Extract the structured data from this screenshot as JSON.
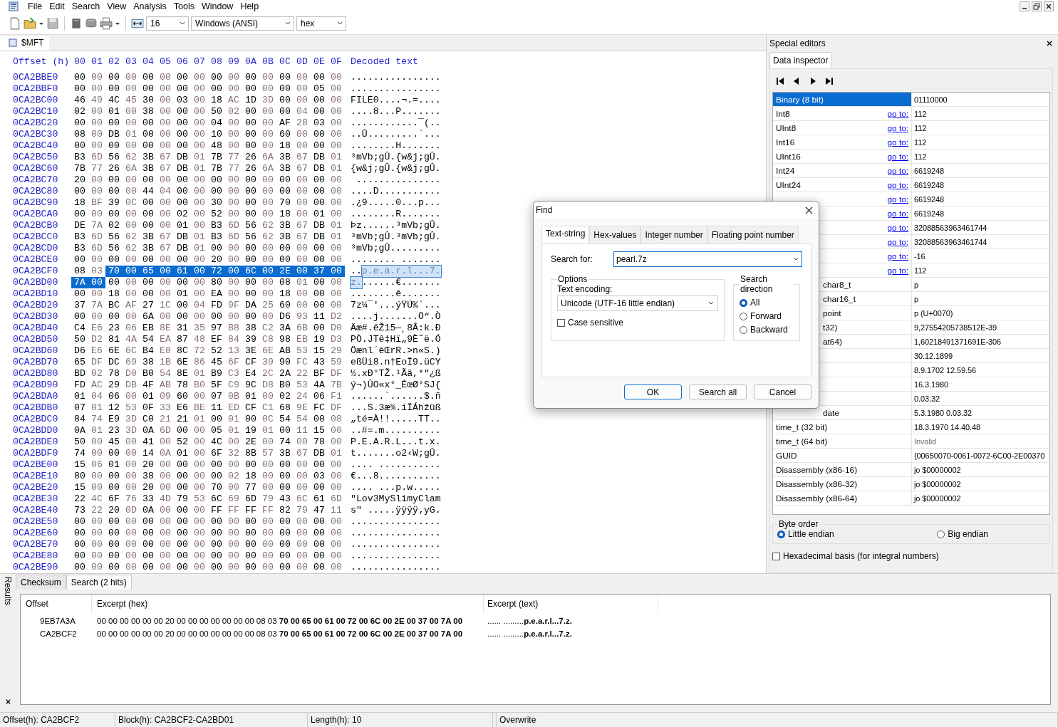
{
  "menu": [
    "File",
    "Edit",
    "Search",
    "View",
    "Analysis",
    "Tools",
    "Window",
    "Help"
  ],
  "toolbar": {
    "columns_value": "16",
    "charset": "Windows (ANSI)",
    "base": "hex"
  },
  "document_tab": {
    "label": "$MFT",
    "selected": true
  },
  "hex_view": {
    "header": {
      "offset": "Offset (h)",
      "columns": [
        "00",
        "01",
        "02",
        "03",
        "04",
        "05",
        "06",
        "07",
        "08",
        "09",
        "0A",
        "0B",
        "0C",
        "0D",
        "0E",
        "0F"
      ],
      "text": "Decoded text"
    },
    "rows": [
      {
        "offset": "0CA2BBE0",
        "hex": [
          {
            "v": "00 00 00 00 00 00 00 00 00 00 00 00 00 00 00 00",
            "selected": false
          }
        ],
        "text": [
          {
            "v": "................",
            "selected": false
          }
        ]
      },
      {
        "offset": "0CA2BBF0",
        "hex": [
          {
            "v": "00 00 00 00 00 00 00 00 00 00 00 00 00 00 05 00",
            "selected": false
          }
        ],
        "text": [
          {
            "v": "................",
            "selected": false
          }
        ]
      },
      {
        "offset": "0CA2BC00",
        "hex": [
          {
            "v": "46 49 4C 45 30 00 03 00 18 AC 1D 3D 00 00 00 00",
            "selected": false
          }
        ],
        "text": [
          {
            "v": "FILE0....¬.=....",
            "selected": false
          }
        ]
      },
      {
        "offset": "0CA2BC10",
        "hex": [
          {
            "v": "02 00 01 00 38 00 00 00 50 02 00 00 00 04 00 00",
            "selected": false
          }
        ],
        "text": [
          {
            "v": "....8...P.......",
            "selected": false
          }
        ]
      },
      {
        "offset": "0CA2BC20",
        "hex": [
          {
            "v": "00 00 00 00 00 00 00 00 04 00 00 00 AF 28 03 00",
            "selected": false
          }
        ],
        "text": [
          {
            "v": "............¯(..",
            "selected": false
          }
        ]
      },
      {
        "offset": "0CA2BC30",
        "hex": [
          {
            "v": "08 00 DB 01 00 00 00 00 10 00 00 00 60 00 00 00",
            "selected": false
          }
        ],
        "text": [
          {
            "v": "..Û.........`...",
            "selected": false
          }
        ]
      },
      {
        "offset": "0CA2BC40",
        "hex": [
          {
            "v": "00 00 00 00 00 00 00 00 48 00 00 00 18 00 00 00",
            "selected": false
          }
        ],
        "text": [
          {
            "v": "........H.......",
            "selected": false
          }
        ]
      },
      {
        "offset": "0CA2BC50",
        "hex": [
          {
            "v": "B3 6D 56 62 3B 67 DB 01 7B 77 26 6A 3B 67 DB 01",
            "selected": false
          }
        ],
        "text": [
          {
            "v": "³mVb;gÛ.{w&j;gÛ.",
            "selected": false
          }
        ]
      },
      {
        "offset": "0CA2BC60",
        "hex": [
          {
            "v": "7B 77 26 6A 3B 67 DB 01 7B 77 26 6A 3B 67 DB 01",
            "selected": false
          }
        ],
        "text": [
          {
            "v": "{w&j;gÛ.{w&j;gÛ.",
            "selected": false
          }
        ]
      },
      {
        "offset": "0CA2BC70",
        "hex": [
          {
            "v": "20 00 00 00 00 00 00 00 00 00 00 00 00 00 00 00",
            "selected": false
          }
        ],
        "text": [
          {
            "v": " ...............",
            "selected": false
          }
        ]
      },
      {
        "offset": "0CA2BC80",
        "hex": [
          {
            "v": "00 00 00 00 44 04 00 00 00 00 00 00 00 00 00 00",
            "selected": false
          }
        ],
        "text": [
          {
            "v": "....D...........",
            "selected": false
          }
        ]
      },
      {
        "offset": "0CA2BC90",
        "hex": [
          {
            "v": "18 BF 39 0C 00 00 00 00 30 00 00 00 70 00 00 00",
            "selected": false
          }
        ],
        "text": [
          {
            "v": ".¿9.....0...p...",
            "selected": false
          }
        ]
      },
      {
        "offset": "0CA2BCA0",
        "hex": [
          {
            "v": "00 00 00 00 00 00 02 00 52 00 00 00 18 00 01 00",
            "selected": false
          }
        ],
        "text": [
          {
            "v": "........R.......",
            "selected": false
          }
        ]
      },
      {
        "offset": "0CA2BCB0",
        "hex": [
          {
            "v": "DE 7A 02 00 00 00 01 00 B3 6D 56 62 3B 67 DB 01",
            "selected": false
          }
        ],
        "text": [
          {
            "v": "Þz......³mVb;gÛ.",
            "selected": false
          }
        ]
      },
      {
        "offset": "0CA2BCC0",
        "hex": [
          {
            "v": "B3 6D 56 62 3B 67 DB 01 B3 6D 56 62 3B 67 DB 01",
            "selected": false
          }
        ],
        "text": [
          {
            "v": "³mVb;gÛ.³mVb;gÛ.",
            "selected": false
          }
        ]
      },
      {
        "offset": "0CA2BCD0",
        "hex": [
          {
            "v": "B3 6D 56 62 3B 67 DB 01 00 00 00 00 00 00 00 00",
            "selected": false
          }
        ],
        "text": [
          {
            "v": "³mVb;gÛ.........",
            "selected": false
          }
        ]
      },
      {
        "offset": "0CA2BCE0",
        "hex": [
          {
            "v": "00 00 00 00 00 00 00 00 20 00 00 00 00 00 00 00",
            "selected": false
          }
        ],
        "text": [
          {
            "v": "........ .......",
            "selected": false
          }
        ]
      },
      {
        "offset": "0CA2BCF0",
        "hex": [
          {
            "v": "08 03",
            "selected": false
          },
          {
            "v": "70 00 65 00 61 00 72 00 6C 00 2E 00 37 00",
            "selected": true
          }
        ],
        "text": [
          {
            "v": "..",
            "selected": false
          },
          {
            "v": "p.e.a.r.l...7.",
            "selected": true
          }
        ]
      },
      {
        "offset": "0CA2BD00",
        "hex": [
          {
            "v": "7A 00",
            "selected": true
          },
          {
            "v": "00 00 00 00 00 00 80 00 00 00 08 01 00 00",
            "selected": false
          }
        ],
        "text": [
          {
            "v": "z.",
            "selected": true
          },
          {
            "v": "......€.......",
            "selected": false
          }
        ]
      },
      {
        "offset": "0CA2BD10",
        "hex": [
          {
            "v": "00 00 18 00 00 00 01 00 EA 00 00 00 18 00 00 00",
            "selected": false
          }
        ],
        "text": [
          {
            "v": "........ê.......",
            "selected": false
          }
        ]
      },
      {
        "offset": "0CA2BD20",
        "hex": [
          {
            "v": "37 7A BC AF 27 1C 00 04 FD 9F DA 25 60 00 00 00",
            "selected": false
          }
        ],
        "text": [
          {
            "v": "7z¼¯'...ýŸÚ%`...",
            "selected": false
          }
        ]
      },
      {
        "offset": "0CA2BD30",
        "hex": [
          {
            "v": "00 00 00 00 6A 00 00 00 00 00 00 00 D6 93 11 D2",
            "selected": false
          }
        ],
        "text": [
          {
            "v": "....j.......Ö“.Ò",
            "selected": false
          }
        ]
      },
      {
        "offset": "0CA2BD40",
        "hex": [
          {
            "v": "C4 E6 23 06 EB 8E 31 35 97 B8 38 C2 3A 6B 00 D0",
            "selected": false
          }
        ],
        "text": [
          {
            "v": "Äæ#.ëŽ15—¸8Â:k.Ð",
            "selected": false
          }
        ]
      },
      {
        "offset": "0CA2BD50",
        "hex": [
          {
            "v": "50 D2 81 4A 54 EA 87 48 EF 84 39 C8 98 EB 19 D3",
            "selected": false
          }
        ],
        "text": [
          {
            "v": "PÒ.JTê‡Hï„9È˜ë.Ó",
            "selected": false
          }
        ]
      },
      {
        "offset": "0CA2BD60",
        "hex": [
          {
            "v": "D6 E6 6E 6C B4 E8 8C 72 52 13 3E 6E AB 53 15 29",
            "selected": false
          }
        ],
        "text": [
          {
            "v": "Öænl´èŒrR.>n«S.)",
            "selected": false
          }
        ]
      },
      {
        "offset": "0CA2BD70",
        "hex": [
          {
            "v": "65 DF DC 69 38 1B 6E 86 45 6F CF 39 90 FC 43 59",
            "selected": false
          }
        ],
        "text": [
          {
            "v": "eßÜi8.n†EoÏ9.üCY",
            "selected": false
          }
        ]
      },
      {
        "offset": "0CA2BD80",
        "hex": [
          {
            "v": "BD 02 78 D0 B0 54 8E 01 B9 C3 E4 2C 2A 22 BF DF",
            "selected": false
          }
        ],
        "text": [
          {
            "v": "½.xÐ°TŽ.¹Ãä,*\"¿ß",
            "selected": false
          }
        ]
      },
      {
        "offset": "0CA2BD90",
        "hex": [
          {
            "v": "FD AC 29 DB 4F AB 78 B0 5F C9 9C D8 B0 53 4A 7B",
            "selected": false
          }
        ],
        "text": [
          {
            "v": "ý¬)ÛO«x°_ÉœØ°SJ{",
            "selected": false
          }
        ]
      },
      {
        "offset": "0CA2BDA0",
        "hex": [
          {
            "v": "01 04 06 00 01 09 60 00 07 0B 01 00 02 24 06 F1",
            "selected": false
          }
        ],
        "text": [
          {
            "v": "......`......$.ñ",
            "selected": false
          }
        ]
      },
      {
        "offset": "0CA2BDB0",
        "hex": [
          {
            "v": "07 01 12 53 0F 33 E6 BE 11 ED CF C1 68 9E FC DF",
            "selected": false
          }
        ],
        "text": [
          {
            "v": "...S.3æ¾.íÏÁhžüß",
            "selected": false
          }
        ]
      },
      {
        "offset": "0CA2BDC0",
        "hex": [
          {
            "v": "84 74 E9 3D C0 21 21 01 00 01 00 0C 54 54 00 08",
            "selected": false
          }
        ],
        "text": [
          {
            "v": "„té=À!!.....TT..",
            "selected": false
          }
        ]
      },
      {
        "offset": "0CA2BDD0",
        "hex": [
          {
            "v": "0A 01 23 3D 0A 6D 00 00 05 01 19 01 00 11 15 00",
            "selected": false
          }
        ],
        "text": [
          {
            "v": "..#=.m..........",
            "selected": false
          }
        ]
      },
      {
        "offset": "0CA2BDE0",
        "hex": [
          {
            "v": "50 00 45 00 41 00 52 00 4C 00 2E 00 74 00 78 00",
            "selected": false
          }
        ],
        "text": [
          {
            "v": "P.E.A.R.L...t.x.",
            "selected": false
          }
        ]
      },
      {
        "offset": "0CA2BDF0",
        "hex": [
          {
            "v": "74 00 00 00 14 0A 01 00 6F 32 8B 57 3B 67 DB 01",
            "selected": false
          }
        ],
        "text": [
          {
            "v": "t.......o2‹W;gÛ.",
            "selected": false
          }
        ]
      },
      {
        "offset": "0CA2BE00",
        "hex": [
          {
            "v": "15 06 01 00 20 00 00 00 00 00 00 00 00 00 00 00",
            "selected": false
          }
        ],
        "text": [
          {
            "v": ".... ...........",
            "selected": false
          }
        ]
      },
      {
        "offset": "0CA2BE10",
        "hex": [
          {
            "v": "80 00 00 00 38 00 00 00 00 02 18 00 00 00 03 00",
            "selected": false
          }
        ],
        "text": [
          {
            "v": "€...8...........",
            "selected": false
          }
        ]
      },
      {
        "offset": "0CA2BE20",
        "hex": [
          {
            "v": "15 00 00 00 20 00 00 00 70 00 77 00 00 00 00 00",
            "selected": false
          }
        ],
        "text": [
          {
            "v": ".... ...p.w.....",
            "selected": false
          }
        ]
      },
      {
        "offset": "0CA2BE30",
        "hex": [
          {
            "v": "22 4C 6F 76 33 4D 79 53 6C 69 6D 79 43 6C 61 6D",
            "selected": false
          }
        ],
        "text": [
          {
            "v": "\"Lov3MySlimyClam",
            "selected": false
          }
        ]
      },
      {
        "offset": "0CA2BE40",
        "hex": [
          {
            "v": "73 22 20 0D 0A 00 00 00 FF FF FF FF 82 79 47 11",
            "selected": false
          }
        ],
        "text": [
          {
            "v": "s\" .....ÿÿÿÿ‚yG.",
            "selected": false
          }
        ]
      },
      {
        "offset": "0CA2BE50",
        "hex": [
          {
            "v": "00 00 00 00 00 00 00 00 00 00 00 00 00 00 00 00",
            "selected": false
          }
        ],
        "text": [
          {
            "v": "................",
            "selected": false
          }
        ]
      },
      {
        "offset": "0CA2BE60",
        "hex": [
          {
            "v": "00 00 00 00 00 00 00 00 00 00 00 00 00 00 00 00",
            "selected": false
          }
        ],
        "text": [
          {
            "v": "................",
            "selected": false
          }
        ]
      },
      {
        "offset": "0CA2BE70",
        "hex": [
          {
            "v": "00 00 00 00 00 00 00 00 00 00 00 00 00 00 00 00",
            "selected": false
          }
        ],
        "text": [
          {
            "v": "................",
            "selected": false
          }
        ]
      },
      {
        "offset": "0CA2BE80",
        "hex": [
          {
            "v": "00 00 00 00 00 00 00 00 00 00 00 00 00 00 00 00",
            "selected": false
          }
        ],
        "text": [
          {
            "v": "................",
            "selected": false
          }
        ]
      },
      {
        "offset": "0CA2BE90",
        "hex": [
          {
            "v": "00 00 00 00 00 00 00 00 00 00 00 00 00 00 00 00",
            "selected": false
          }
        ],
        "text": [
          {
            "v": "................",
            "selected": false
          }
        ]
      }
    ]
  },
  "special_editors": {
    "title": "Special editors",
    "tab": {
      "label": "Data inspector",
      "selected": true
    },
    "inspector_rows": [
      {
        "kind": "full",
        "name": "Binary (8 bit)",
        "value": "01110000",
        "selected": true,
        "grayed": false
      },
      {
        "kind": "full",
        "name": "Int8",
        "link": "go to:",
        "value": "112",
        "selected": false,
        "grayed": false
      },
      {
        "kind": "full",
        "name": "UInt8",
        "link": "go to:",
        "value": "112",
        "selected": false,
        "grayed": false
      },
      {
        "kind": "full",
        "name": "Int16",
        "link": "go to:",
        "value": "112",
        "selected": false,
        "grayed": false
      },
      {
        "kind": "full",
        "name": "UInt16",
        "link": "go to:",
        "value": "112",
        "selected": false,
        "grayed": false
      },
      {
        "kind": "full",
        "name": "Int24",
        "link": "go to:",
        "value": "6619248",
        "selected": false,
        "grayed": false
      },
      {
        "kind": "full",
        "name": "UInt24",
        "link": "go to:",
        "value": "6619248",
        "selected": false,
        "grayed": false
      },
      {
        "kind": "hidden",
        "link": "go to:",
        "value": "6619248",
        "selected": false,
        "grayed": false
      },
      {
        "kind": "hidden",
        "link": "go to:",
        "value": "6619248",
        "selected": false,
        "grayed": false
      },
      {
        "kind": "hidden",
        "link": "go to:",
        "value": "32088563963461744",
        "selected": false,
        "grayed": false
      },
      {
        "kind": "hidden",
        "link": "go to:",
        "value": "32088563963461744",
        "selected": false,
        "grayed": false
      },
      {
        "kind": "hidden",
        "link": "go to:",
        "value": "-16",
        "selected": false,
        "grayed": false
      },
      {
        "kind": "hidden",
        "link": "go to:",
        "value": "112",
        "selected": false,
        "grayed": false
      },
      {
        "kind": "clipped",
        "name": "char8_t",
        "value": "p",
        "selected": false,
        "grayed": false
      },
      {
        "kind": "clipped",
        "name": "char16_t",
        "value": "p",
        "selected": false,
        "grayed": false
      },
      {
        "kind": "clipped",
        "name": "point",
        "value": "p (U+0070)",
        "selected": false,
        "grayed": false
      },
      {
        "kind": "clipped",
        "name": "t32)",
        "value": "9,27554205738512E-39",
        "selected": false,
        "grayed": false
      },
      {
        "kind": "clipped",
        "name": "at64)",
        "value": "1,60218491371691E-306",
        "selected": false,
        "grayed": false
      },
      {
        "kind": "hidden",
        "value": "30.12.1899",
        "selected": false,
        "grayed": false
      },
      {
        "kind": "hidden",
        "value": "8.9.1702 12.59.56",
        "selected": false,
        "grayed": false
      },
      {
        "kind": "hidden",
        "value": "16.3.1980",
        "selected": false,
        "grayed": false
      },
      {
        "kind": "hidden",
        "value": "0.03.32",
        "selected": false,
        "grayed": false
      },
      {
        "kind": "clipped",
        "name": "date",
        "value": "5.3.1980 0.03.32",
        "selected": false,
        "grayed": false
      },
      {
        "kind": "full",
        "name": "time_t (32 bit)",
        "value": "18.3.1970 14.40.48",
        "selected": false,
        "grayed": false
      },
      {
        "kind": "full",
        "name": "time_t (64 bit)",
        "value": "Invalid",
        "selected": false,
        "grayed": true
      },
      {
        "kind": "full",
        "name": "GUID",
        "value": "{00650070-0061-0072-6C00-2E00370",
        "selected": false,
        "grayed": false
      },
      {
        "kind": "full",
        "name": "Disassembly (x86-16)",
        "value": "jo $00000002",
        "selected": false,
        "grayed": false
      },
      {
        "kind": "full",
        "name": "Disassembly (x86-32)",
        "value": "jo $00000002",
        "selected": false,
        "grayed": false
      },
      {
        "kind": "full",
        "name": "Disassembly (x86-64)",
        "value": "jo $00000002",
        "selected": false,
        "grayed": false
      }
    ],
    "byte_order": {
      "label": "Byte order",
      "options": [
        {
          "label": "Little endian",
          "selected": true
        },
        {
          "label": "Big endian",
          "selected": false
        }
      ]
    },
    "hex_basis": {
      "label": "Hexadecimal basis (for integral numbers)",
      "checked": false
    }
  },
  "results": {
    "label": "Results",
    "tabs": [
      {
        "label": "Checksum",
        "selected": false
      },
      {
        "label": "Search (2 hits)",
        "selected": true
      }
    ],
    "columns": [
      "Offset",
      "Excerpt (hex)",
      "Excerpt (text)"
    ],
    "rows": [
      {
        "offset": "9EB7A3A",
        "hex": "00 00 00 00 00 00 20 00 00 00 00 00 00 00 08 03 **70 00 65 00 61 00 72 00 6C 00 2E 00 37 00 7A 00**",
        "text": "...... .........**p.e.a.r.l...7.z.**"
      },
      {
        "offset": "CA2BCF2",
        "hex": "00 00 00 00 00 00 20 00 00 00 00 00 00 00 08 03 **70 00 65 00 61 00 72 00 6C 00 2E 00 37 00 7A 00**",
        "text": "...... .........**p.e.a.r.l...7.z.**"
      }
    ]
  },
  "status_bar": [
    "Offset(h): CA2BCF2",
    "Block(h): CA2BCF2-CA2BD01",
    "Length(h): 10",
    "Overwrite"
  ],
  "find_dialog": {
    "title": "Find",
    "tabs": [
      {
        "label": "Text-string",
        "selected": true
      },
      {
        "label": "Hex-values",
        "selected": false
      },
      {
        "label": "Integer number",
        "selected": false
      },
      {
        "label": "Floating point number",
        "selected": false
      }
    ],
    "search_label": "Search for:",
    "search_value": "pearl.7z",
    "options_label": "Options",
    "encoding_label": "Text encoding:",
    "encoding": "Unicode (UTF-16 little endian)",
    "case_sensitive": {
      "label": "Case sensitive",
      "checked": false
    },
    "direction": {
      "label": "Search direction",
      "options": [
        {
          "label": "All",
          "selected": true
        },
        {
          "label": "Forward",
          "selected": false
        },
        {
          "label": "Backward",
          "selected": false
        }
      ]
    },
    "buttons": [
      "OK",
      "Search all",
      "Cancel"
    ]
  }
}
